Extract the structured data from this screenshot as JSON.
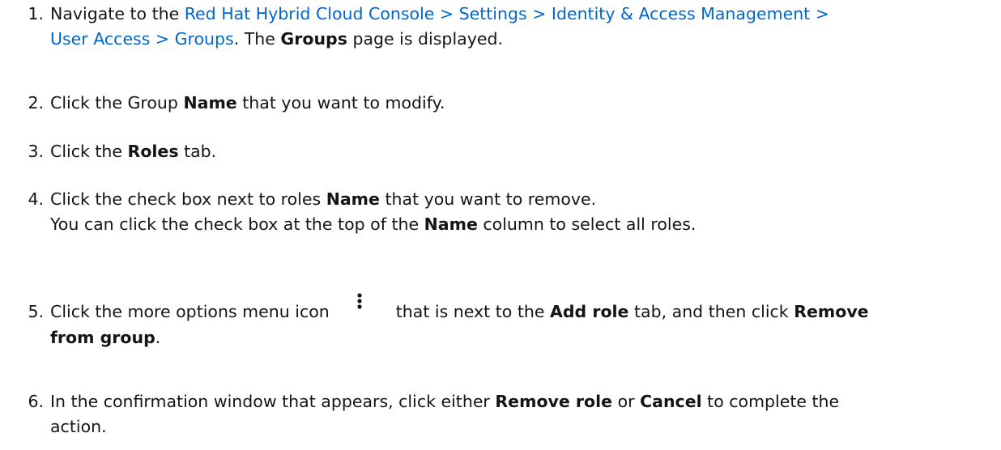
{
  "steps": [
    {
      "number": "1.",
      "intro": "Navigate to the ",
      "breadcrumb_line1": "Red Hat Hybrid Cloud Console > Settings > Identity & Access Management >",
      "breadcrumb_line2": "User Access > Groups",
      "after_link": ". The ",
      "bold": "Groups",
      "tail": " page is displayed."
    },
    {
      "number": "2.",
      "pre": "Click the Group ",
      "bold": "Name",
      "post": " that you want to modify."
    },
    {
      "number": "3.",
      "pre": "Click the ",
      "bold": "Roles",
      "post": " tab."
    },
    {
      "number": "4.",
      "line1_pre": "Click the check box next to roles ",
      "line1_bold": "Name",
      "line1_post": " that you want to remove.",
      "line2_pre": "You can click the check box at the top of the ",
      "line2_bold": "Name",
      "line2_post": " column to select all roles."
    },
    {
      "number": "5.",
      "pre": "Click the more options menu icon",
      "icon": "kebab-vertical-icon",
      "mid": "that is next to the ",
      "bold1": "Add role",
      "mid2": " tab, and then click ",
      "bold2a": "Remove",
      "bold2b": "from group",
      "post": "."
    },
    {
      "number": "6.",
      "pre": "In the confirmation window that appears, click either ",
      "bold1": "Remove role",
      "mid": " or ",
      "bold2": "Cancel",
      "post": " to complete the",
      "line2": "action."
    }
  ]
}
